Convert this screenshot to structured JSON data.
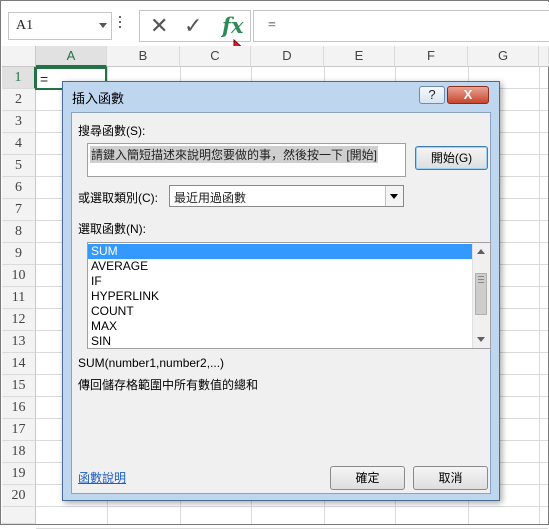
{
  "formula_bar": {
    "name_box": "A1",
    "cancel_icon": "✕",
    "enter_icon": "✓",
    "fx_label": "fx",
    "formula": "="
  },
  "grid": {
    "columns": [
      "A",
      "B",
      "C",
      "D",
      "E",
      "F",
      "G"
    ],
    "rows": [
      "1",
      "2",
      "3",
      "4",
      "5",
      "6",
      "7",
      "8",
      "9",
      "10",
      "11",
      "12",
      "13",
      "14",
      "15",
      "16",
      "17",
      "18",
      "19",
      "20"
    ],
    "active_cell_value": "=",
    "accent_color": "#217346"
  },
  "dialog": {
    "title": "插入函數",
    "help_btn": "?",
    "close_btn": "X",
    "search_label": "搜尋函數(S):",
    "search_value": "請鍵入簡短描述來說明您要做的事，然後按一下 [開始]",
    "go_btn": "開始(G)",
    "category_label": "或選取類別(C):",
    "category_value": "最近用過函數",
    "select_label": "選取函數(N):",
    "functions": [
      "SUM",
      "AVERAGE",
      "IF",
      "HYPERLINK",
      "COUNT",
      "MAX",
      "SIN"
    ],
    "selected_function": "SUM",
    "signature": "SUM(number1,number2,...)",
    "description": "傳回儲存格範圍中所有數值的總和",
    "help_link": "函數說明",
    "ok_btn": "確定",
    "cancel_btn": "取消"
  }
}
